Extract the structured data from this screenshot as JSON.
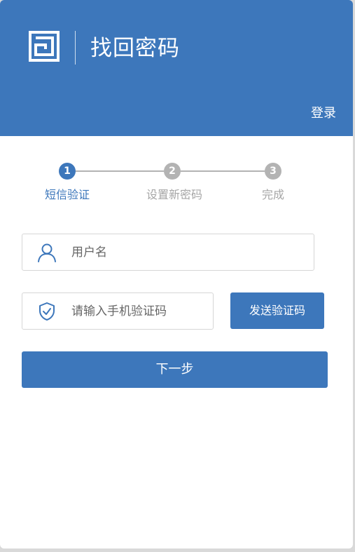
{
  "header": {
    "title": "找回密码",
    "login_link": "登录"
  },
  "steps": [
    {
      "number": "1",
      "label": "短信验证",
      "active": true
    },
    {
      "number": "2",
      "label": "设置新密码",
      "active": false
    },
    {
      "number": "3",
      "label": "完成",
      "active": false
    }
  ],
  "form": {
    "username_placeholder": "用户名",
    "sms_code_placeholder": "请输入手机验证码",
    "send_code_label": "发送验证码",
    "next_label": "下一步"
  },
  "colors": {
    "primary": "#3d77bb",
    "inactive_step": "#b3b3b3"
  },
  "icons": {
    "logo": "logo-icon",
    "username": "user-icon",
    "sms_code": "shield-check-icon"
  }
}
